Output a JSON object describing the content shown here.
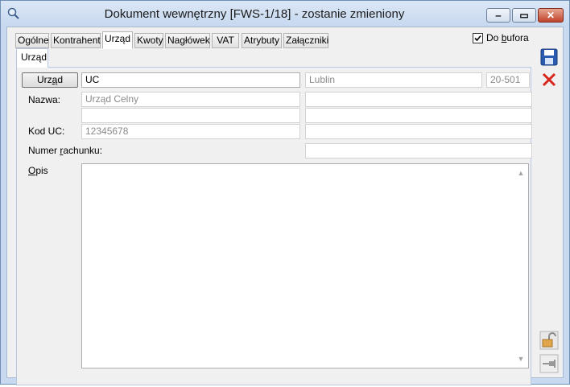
{
  "window": {
    "title": "Dokument wewnętrzny [FWS-1/18]  - zostanie zmieniony",
    "minimize_glyph": "‒",
    "maximize_glyph": "▭",
    "close_glyph": "✕"
  },
  "tabs": [
    "Ogólne",
    "Kontrahent",
    "Urząd",
    "Kwoty",
    "Nagłówek",
    "VAT",
    "Atrybuty",
    "Załączniki"
  ],
  "active_tab": "Urząd",
  "do_bufora": {
    "label_pre": "Do ",
    "label_u": "b",
    "label_post": "ufora",
    "checked": true
  },
  "subtab": "Urząd",
  "form": {
    "urzad_button_pre": "Urz",
    "urzad_button_u": "ą",
    "urzad_button_post": "d",
    "urzad_code": "UC",
    "city": "Lublin",
    "postal_code": "20-501",
    "nazwa_label": "Nazwa:",
    "nazwa_value": "Urząd Celny",
    "nazwa_line2": "",
    "kod_label": "Kod UC:",
    "kod_value": "12345678",
    "numer_label_pre": "Numer ",
    "numer_label_u": "r",
    "numer_label_post": "achunku:",
    "numer_value": "",
    "opis_label_u": "O",
    "opis_label_post": "pis",
    "opis_value": ""
  },
  "right_toolbar": [
    "save-icon",
    "cancel-icon",
    "lock-icon",
    "pin-icon"
  ],
  "colors": {
    "accent": "#2a5db0",
    "cancel": "#d9261c",
    "titlebar": "#c6d8ef"
  }
}
